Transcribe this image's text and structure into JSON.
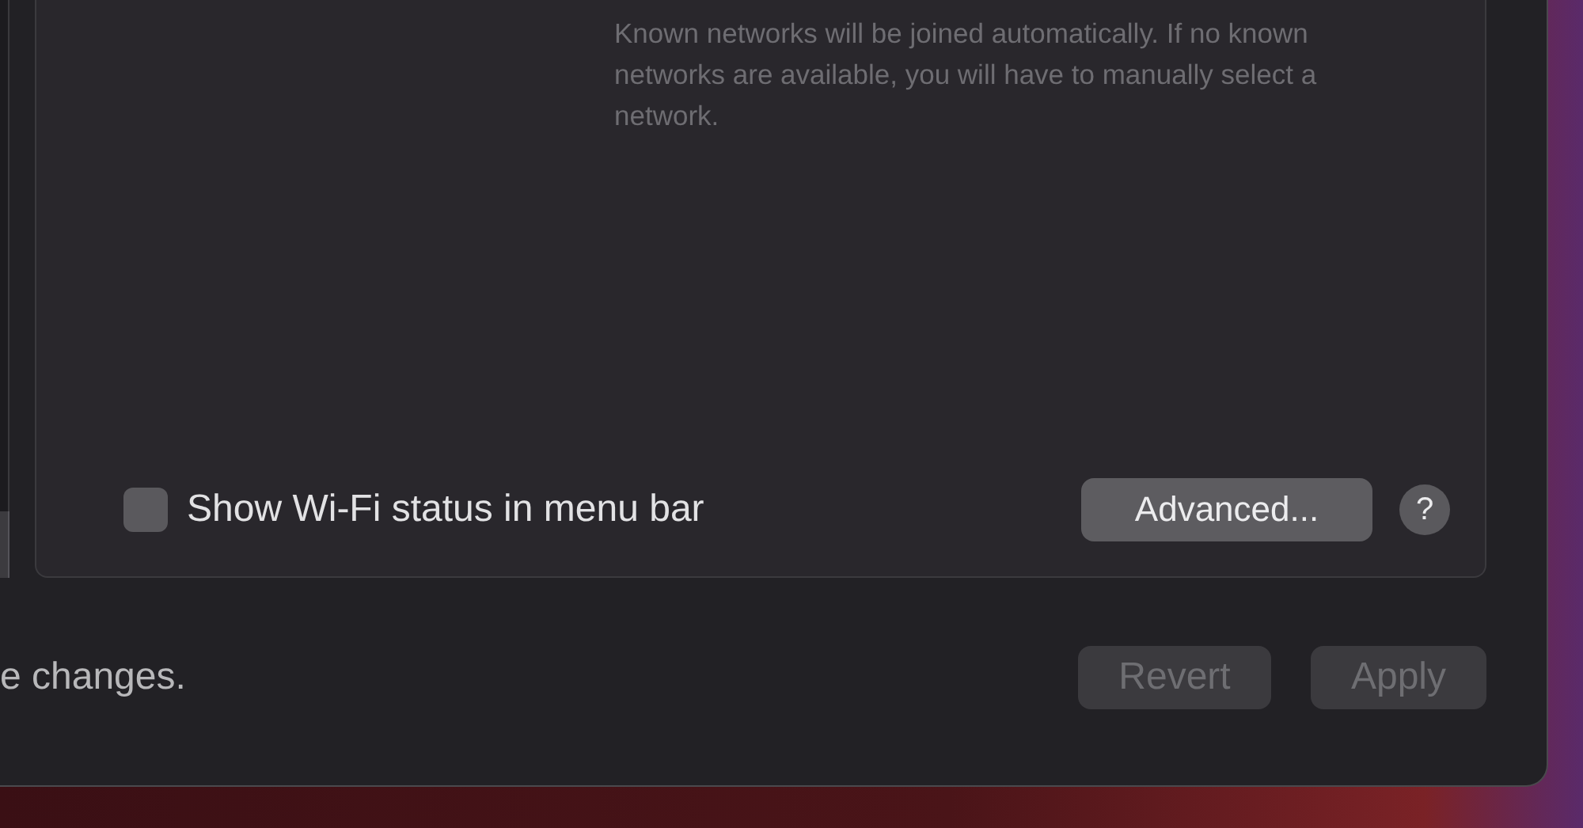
{
  "panel": {
    "hint": "Known networks will be joined automatically. If no known networks are available, you will have to manually select a network.",
    "status_checkbox": {
      "label": "Show Wi-Fi status in menu bar",
      "checked": false
    },
    "advanced_button": {
      "label": "Advanced..."
    },
    "help_button": {
      "label": "?"
    }
  },
  "footer": {
    "note": "e changes.",
    "buttons": [
      {
        "label": "Revert",
        "disabled": true
      },
      {
        "label": "Apply",
        "disabled": true
      }
    ]
  }
}
